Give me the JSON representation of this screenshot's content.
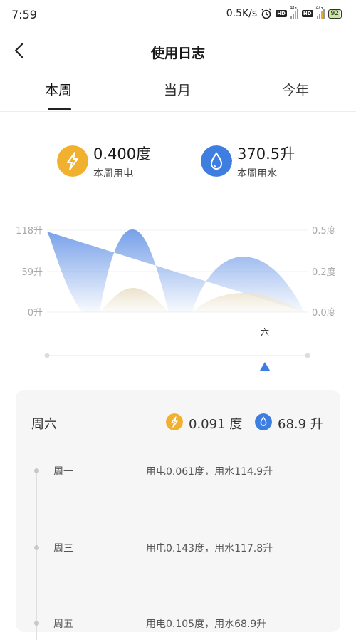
{
  "status_bar": {
    "time": "7:59",
    "speed": "0.5K/s",
    "hd": "HD",
    "network": "4G",
    "battery": "92"
  },
  "header": {
    "title": "使用日志"
  },
  "tabs": [
    {
      "label": "本周",
      "active": true
    },
    {
      "label": "当月",
      "active": false
    },
    {
      "label": "今年",
      "active": false
    }
  ],
  "summary": {
    "electricity": {
      "value": "0.400度",
      "label": "本周用电",
      "icon": "lightning-icon",
      "color": "#f2b02f"
    },
    "water": {
      "value": "370.5升",
      "label": "本周用水",
      "icon": "water-drop-icon",
      "color": "#3d7ee0"
    }
  },
  "chart_data": {
    "type": "area",
    "left_axis_ticks": [
      "118升",
      "59升",
      "0升"
    ],
    "right_axis_ticks": [
      "0.5度",
      "0.2度",
      "0.0度"
    ],
    "x_label_selected": "六",
    "series": [
      {
        "name": "用水",
        "unit": "升",
        "color": "#6f9be8"
      },
      {
        "name": "用电",
        "unit": "度",
        "color": "#e8dcc4"
      }
    ]
  },
  "detail": {
    "day": "周六",
    "electricity": "0.091 度",
    "water": "68.9 升",
    "entries": [
      {
        "day": "周一",
        "detail": "用电0.061度，用水114.9升"
      },
      {
        "day": "周三",
        "detail": "用电0.143度，用水117.8升"
      },
      {
        "day": "周五",
        "detail": "用电0.105度，用水68.9升"
      }
    ]
  },
  "colors": {
    "accent_yellow": "#f2b02f",
    "accent_blue": "#3d7ee0",
    "selection_triangle": "#3d7ee0"
  }
}
